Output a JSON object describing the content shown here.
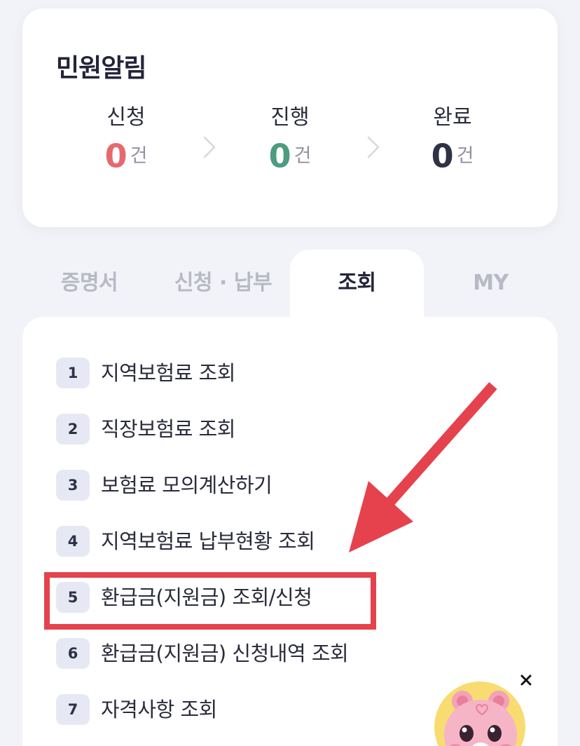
{
  "status_card": {
    "title": "민원알림",
    "stats": [
      {
        "label": "신청",
        "count": "0",
        "unit": "건",
        "color": "#e46a6e"
      },
      {
        "label": "진행",
        "count": "0",
        "unit": "건",
        "color": "#4e9b80"
      },
      {
        "label": "완료",
        "count": "0",
        "unit": "건",
        "color": "#2f3147"
      }
    ]
  },
  "tabs": [
    {
      "label": "증명서",
      "active": false
    },
    {
      "label": "신청 · 납부",
      "active": false
    },
    {
      "label": "조회",
      "active": true
    },
    {
      "label": "MY",
      "active": false
    }
  ],
  "menu_items": [
    {
      "num": "1",
      "label": "지역보험료 조회"
    },
    {
      "num": "2",
      "label": "직장보험료 조회"
    },
    {
      "num": "3",
      "label": "보험료 모의계산하기"
    },
    {
      "num": "4",
      "label": "지역보험료 납부현황 조회"
    },
    {
      "num": "5",
      "label": "환급금(지원금) 조회/신청"
    },
    {
      "num": "6",
      "label": "환급금(지원금) 신청내역 조회"
    },
    {
      "num": "7",
      "label": "자격사항 조회"
    }
  ],
  "annotation": {
    "highlighted_item": "5",
    "color": "#e5424d"
  },
  "mascot": {
    "icon": "mascot-bear-icon",
    "close_icon": "close-icon",
    "background": "#f8dc71"
  }
}
